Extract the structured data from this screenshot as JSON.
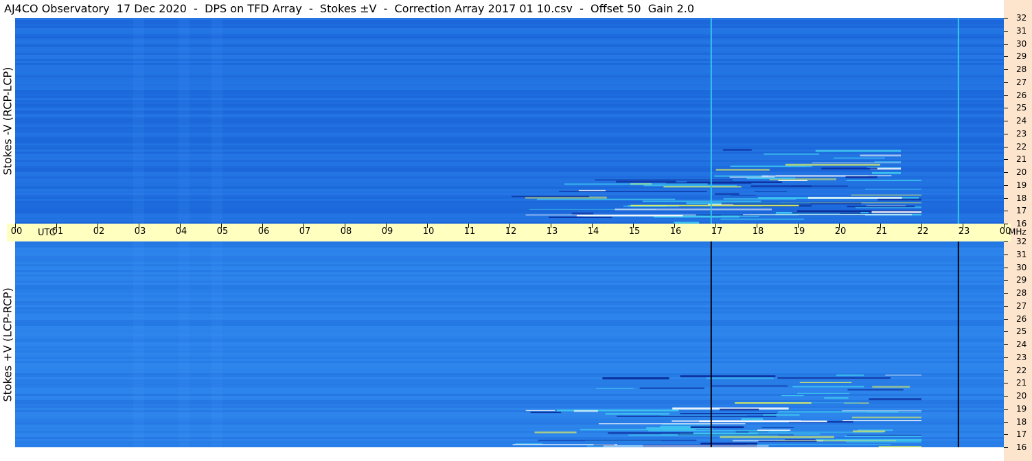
{
  "title": "AJ4CO Observatory  17 Dec 2020  -  DPS on TFD Array  -  Stokes ±V  -  Correction Array 2017 01 10.csv  -  Offset 50  Gain 2.0",
  "chart_data": {
    "type": "heatmap",
    "title": "AJ4CO Observatory  17 Dec 2020  -  DPS on TFD Array  -  Stokes ±V  -  Correction Array 2017 01 10.csv  -  Offset 50  Gain 2.0",
    "xlabel": "UTC",
    "ylabel_unit": "MHz",
    "x_ticks": [
      "00",
      "01",
      "02",
      "03",
      "04",
      "05",
      "06",
      "07",
      "08",
      "09",
      "10",
      "11",
      "12",
      "13",
      "14",
      "15",
      "16",
      "17",
      "18",
      "19",
      "20",
      "21",
      "22",
      "23",
      "00"
    ],
    "x_range_hours": [
      0,
      24
    ],
    "y_ticks": [
      "32",
      "31",
      "30",
      "29",
      "28",
      "27",
      "26",
      "25",
      "24",
      "23",
      "22",
      "21",
      "20",
      "19",
      "18",
      "17",
      "16"
    ],
    "y_range_mhz": [
      16,
      32
    ],
    "panels": [
      {
        "name": "Stokes -V (RCP-LCP)",
        "background": "#1f6fe0",
        "vertical_lines": [
          {
            "utc": 16.88,
            "color": "#33c8e8"
          },
          {
            "utc": 22.88,
            "color": "#33c8e8"
          }
        ],
        "activity": [
          {
            "utc_start": 12.0,
            "utc_end": 22.0,
            "mhz_start": 16.0,
            "mhz_end": 19.5,
            "level": "high"
          },
          {
            "utc_start": 16.0,
            "utc_end": 21.5,
            "mhz_start": 19.5,
            "mhz_end": 22.0,
            "level": "medium"
          }
        ]
      },
      {
        "name": "Stokes +V (LCP-RCP)",
        "background": "#2a82ea",
        "vertical_lines": [
          {
            "utc": 16.88,
            "color": "#000000"
          },
          {
            "utc": 22.88,
            "color": "#000000"
          }
        ],
        "activity": [
          {
            "utc_start": 12.0,
            "utc_end": 22.0,
            "mhz_start": 16.0,
            "mhz_end": 19.0,
            "level": "high"
          },
          {
            "utc_start": 14.0,
            "utc_end": 22.0,
            "mhz_start": 19.0,
            "mhz_end": 22.0,
            "level": "medium"
          }
        ]
      }
    ],
    "colors": {
      "base": "#1f6fe0",
      "dark": "#0a2a9a",
      "bright": "#40c8f0",
      "hot": "#e0f060",
      "timebar": "#ffffc0",
      "freq_strip": "#fde4cc"
    }
  },
  "labels": {
    "top_panel": "Stokes -V (RCP-LCP)",
    "bottom_panel": "Stokes +V (LCP-RCP)",
    "utc": "UTC",
    "mhz": "MHz"
  }
}
